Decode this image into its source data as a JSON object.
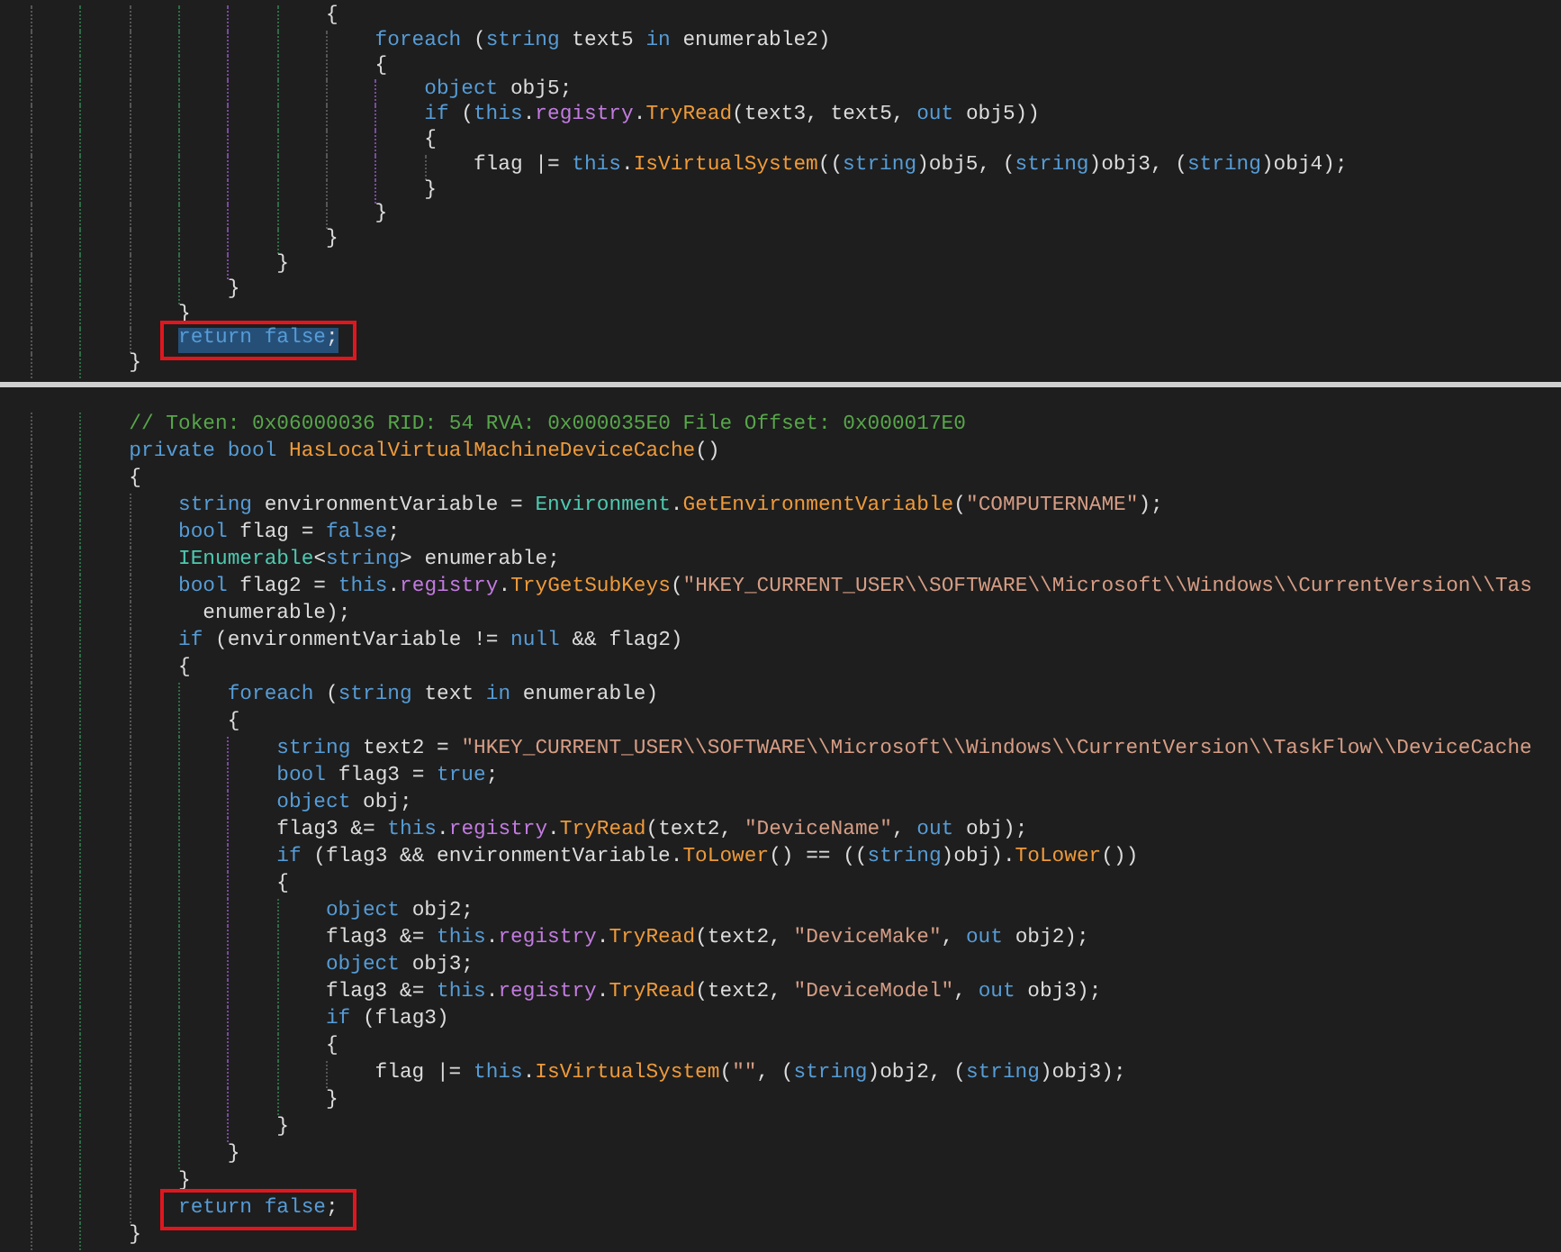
{
  "panels": [
    {
      "lines": [
        {
          "tokens": [
            {
              "kind": "plain",
              "text": "                        {"
            }
          ],
          "selected": false,
          "boxed": false
        },
        {
          "tokens": [
            {
              "kind": "kw",
              "text": "                            foreach"
            },
            {
              "kind": "plain",
              "text": " ("
            },
            {
              "kind": "kw",
              "text": "string"
            },
            {
              "kind": "plain",
              "text": " text5 "
            },
            {
              "kind": "kw",
              "text": "in"
            },
            {
              "kind": "plain",
              "text": " enumerable2)"
            }
          ],
          "selected": false,
          "boxed": false
        },
        {
          "tokens": [
            {
              "kind": "plain",
              "text": "                            {"
            }
          ],
          "selected": false,
          "boxed": false
        },
        {
          "tokens": [
            {
              "kind": "kw",
              "text": "                                object"
            },
            {
              "kind": "plain",
              "text": " obj5;"
            }
          ],
          "selected": false,
          "boxed": false
        },
        {
          "tokens": [
            {
              "kind": "kw",
              "text": "                                if"
            },
            {
              "kind": "plain",
              "text": " ("
            },
            {
              "kind": "kw",
              "text": "this"
            },
            {
              "kind": "plain",
              "text": "."
            },
            {
              "kind": "field",
              "text": "registry"
            },
            {
              "kind": "plain",
              "text": "."
            },
            {
              "kind": "method",
              "text": "TryRead"
            },
            {
              "kind": "plain",
              "text": "(text3, text5, "
            },
            {
              "kind": "kw",
              "text": "out"
            },
            {
              "kind": "plain",
              "text": " obj5))"
            }
          ],
          "selected": false,
          "boxed": false
        },
        {
          "tokens": [
            {
              "kind": "plain",
              "text": "                                {"
            }
          ],
          "selected": false,
          "boxed": false
        },
        {
          "tokens": [
            {
              "kind": "plain",
              "text": "                                    flag |= "
            },
            {
              "kind": "kw",
              "text": "this"
            },
            {
              "kind": "plain",
              "text": "."
            },
            {
              "kind": "method",
              "text": "IsVirtualSystem"
            },
            {
              "kind": "plain",
              "text": "(("
            },
            {
              "kind": "kw",
              "text": "string"
            },
            {
              "kind": "plain",
              "text": ")obj5, ("
            },
            {
              "kind": "kw",
              "text": "string"
            },
            {
              "kind": "plain",
              "text": ")obj3, ("
            },
            {
              "kind": "kw",
              "text": "string"
            },
            {
              "kind": "plain",
              "text": ")obj4);"
            }
          ],
          "selected": false,
          "boxed": false
        },
        {
          "tokens": [
            {
              "kind": "plain",
              "text": "                                }"
            }
          ],
          "selected": false,
          "boxed": false
        },
        {
          "tokens": [
            {
              "kind": "plain",
              "text": "                            }"
            }
          ],
          "selected": false,
          "boxed": false
        },
        {
          "tokens": [
            {
              "kind": "plain",
              "text": "                        }"
            }
          ],
          "selected": false,
          "boxed": false
        },
        {
          "tokens": [
            {
              "kind": "plain",
              "text": "                    }"
            }
          ],
          "selected": false,
          "boxed": false
        },
        {
          "tokens": [
            {
              "kind": "plain",
              "text": "                }"
            }
          ],
          "selected": false,
          "boxed": false
        },
        {
          "tokens": [
            {
              "kind": "plain",
              "text": "            }"
            }
          ],
          "selected": false,
          "boxed": false
        },
        {
          "tokens": [
            {
              "kind": "kw",
              "text": "            return"
            },
            {
              "kind": "kw",
              "text": " false"
            },
            {
              "kind": "plain",
              "text": ";"
            }
          ],
          "selected": true,
          "boxed": true
        },
        {
          "tokens": [
            {
              "kind": "plain",
              "text": "        }"
            }
          ],
          "selected": false,
          "boxed": false
        }
      ]
    },
    {
      "lines": [
        {
          "tokens": [
            {
              "kind": "comment",
              "text": "        // Token: 0x06000036 RID: 54 RVA: 0x000035E0 File Offset: 0x000017E0"
            }
          ],
          "selected": false,
          "boxed": false
        },
        {
          "tokens": [
            {
              "kind": "kw",
              "text": "        private"
            },
            {
              "kind": "kw",
              "text": " bool"
            },
            {
              "kind": "method",
              "text": " HasLocalVirtualMachineDeviceCache"
            },
            {
              "kind": "plain",
              "text": "()"
            }
          ],
          "selected": false,
          "boxed": false
        },
        {
          "tokens": [
            {
              "kind": "plain",
              "text": "        {"
            }
          ],
          "selected": false,
          "boxed": false
        },
        {
          "tokens": [
            {
              "kind": "kw",
              "text": "            string"
            },
            {
              "kind": "plain",
              "text": " environmentVariable = "
            },
            {
              "kind": "type",
              "text": "Environment"
            },
            {
              "kind": "plain",
              "text": "."
            },
            {
              "kind": "method",
              "text": "GetEnvironmentVariable"
            },
            {
              "kind": "plain",
              "text": "("
            },
            {
              "kind": "string",
              "text": "\"COMPUTERNAME\""
            },
            {
              "kind": "plain",
              "text": ");"
            }
          ],
          "selected": false,
          "boxed": false
        },
        {
          "tokens": [
            {
              "kind": "kw",
              "text": "            bool"
            },
            {
              "kind": "plain",
              "text": " flag = "
            },
            {
              "kind": "kw",
              "text": "false"
            },
            {
              "kind": "plain",
              "text": ";"
            }
          ],
          "selected": false,
          "boxed": false
        },
        {
          "tokens": [
            {
              "kind": "type",
              "text": "            IEnumerable"
            },
            {
              "kind": "plain",
              "text": "<"
            },
            {
              "kind": "kw",
              "text": "string"
            },
            {
              "kind": "plain",
              "text": "> enumerable;"
            }
          ],
          "selected": false,
          "boxed": false
        },
        {
          "tokens": [
            {
              "kind": "kw",
              "text": "            bool"
            },
            {
              "kind": "plain",
              "text": " flag2 = "
            },
            {
              "kind": "kw",
              "text": "this"
            },
            {
              "kind": "plain",
              "text": "."
            },
            {
              "kind": "field",
              "text": "registry"
            },
            {
              "kind": "plain",
              "text": "."
            },
            {
              "kind": "method",
              "text": "TryGetSubKeys"
            },
            {
              "kind": "plain",
              "text": "("
            },
            {
              "kind": "string",
              "text": "\"HKEY_CURRENT_USER\\\\SOFTWARE\\\\Microsoft\\\\Windows\\\\CurrentVersion\\\\Tas"
            }
          ],
          "selected": false,
          "boxed": false
        },
        {
          "tokens": [
            {
              "kind": "plain",
              "text": "              enumerable);"
            }
          ],
          "selected": false,
          "boxed": false
        },
        {
          "tokens": [
            {
              "kind": "kw",
              "text": "            if"
            },
            {
              "kind": "plain",
              "text": " (environmentVariable != "
            },
            {
              "kind": "kw",
              "text": "null"
            },
            {
              "kind": "plain",
              "text": " && flag2)"
            }
          ],
          "selected": false,
          "boxed": false
        },
        {
          "tokens": [
            {
              "kind": "plain",
              "text": "            {"
            }
          ],
          "selected": false,
          "boxed": false
        },
        {
          "tokens": [
            {
              "kind": "kw",
              "text": "                foreach"
            },
            {
              "kind": "plain",
              "text": " ("
            },
            {
              "kind": "kw",
              "text": "string"
            },
            {
              "kind": "plain",
              "text": " text "
            },
            {
              "kind": "kw",
              "text": "in"
            },
            {
              "kind": "plain",
              "text": " enumerable)"
            }
          ],
          "selected": false,
          "boxed": false
        },
        {
          "tokens": [
            {
              "kind": "plain",
              "text": "                {"
            }
          ],
          "selected": false,
          "boxed": false
        },
        {
          "tokens": [
            {
              "kind": "kw",
              "text": "                    string"
            },
            {
              "kind": "plain",
              "text": " text2 = "
            },
            {
              "kind": "string",
              "text": "\"HKEY_CURRENT_USER\\\\SOFTWARE\\\\Microsoft\\\\Windows\\\\CurrentVersion\\\\TaskFlow\\\\DeviceCache"
            }
          ],
          "selected": false,
          "boxed": false
        },
        {
          "tokens": [
            {
              "kind": "kw",
              "text": "                    bool"
            },
            {
              "kind": "plain",
              "text": " flag3 = "
            },
            {
              "kind": "kw",
              "text": "true"
            },
            {
              "kind": "plain",
              "text": ";"
            }
          ],
          "selected": false,
          "boxed": false
        },
        {
          "tokens": [
            {
              "kind": "kw",
              "text": "                    object"
            },
            {
              "kind": "plain",
              "text": " obj;"
            }
          ],
          "selected": false,
          "boxed": false
        },
        {
          "tokens": [
            {
              "kind": "plain",
              "text": "                    flag3 &= "
            },
            {
              "kind": "kw",
              "text": "this"
            },
            {
              "kind": "plain",
              "text": "."
            },
            {
              "kind": "field",
              "text": "registry"
            },
            {
              "kind": "plain",
              "text": "."
            },
            {
              "kind": "method",
              "text": "TryRead"
            },
            {
              "kind": "plain",
              "text": "(text2, "
            },
            {
              "kind": "string",
              "text": "\"DeviceName\""
            },
            {
              "kind": "plain",
              "text": ", "
            },
            {
              "kind": "kw",
              "text": "out"
            },
            {
              "kind": "plain",
              "text": " obj);"
            }
          ],
          "selected": false,
          "boxed": false
        },
        {
          "tokens": [
            {
              "kind": "kw",
              "text": "                    if"
            },
            {
              "kind": "plain",
              "text": " (flag3 && environmentVariable."
            },
            {
              "kind": "method",
              "text": "ToLower"
            },
            {
              "kind": "plain",
              "text": "() == (("
            },
            {
              "kind": "kw",
              "text": "string"
            },
            {
              "kind": "plain",
              "text": ")obj)."
            },
            {
              "kind": "method",
              "text": "ToLower"
            },
            {
              "kind": "plain",
              "text": "())"
            }
          ],
          "selected": false,
          "boxed": false
        },
        {
          "tokens": [
            {
              "kind": "plain",
              "text": "                    {"
            }
          ],
          "selected": false,
          "boxed": false
        },
        {
          "tokens": [
            {
              "kind": "kw",
              "text": "                        object"
            },
            {
              "kind": "plain",
              "text": " obj2;"
            }
          ],
          "selected": false,
          "boxed": false
        },
        {
          "tokens": [
            {
              "kind": "plain",
              "text": "                        flag3 &= "
            },
            {
              "kind": "kw",
              "text": "this"
            },
            {
              "kind": "plain",
              "text": "."
            },
            {
              "kind": "field",
              "text": "registry"
            },
            {
              "kind": "plain",
              "text": "."
            },
            {
              "kind": "method",
              "text": "TryRead"
            },
            {
              "kind": "plain",
              "text": "(text2, "
            },
            {
              "kind": "string",
              "text": "\"DeviceMake\""
            },
            {
              "kind": "plain",
              "text": ", "
            },
            {
              "kind": "kw",
              "text": "out"
            },
            {
              "kind": "plain",
              "text": " obj2);"
            }
          ],
          "selected": false,
          "boxed": false
        },
        {
          "tokens": [
            {
              "kind": "kw",
              "text": "                        object"
            },
            {
              "kind": "plain",
              "text": " obj3;"
            }
          ],
          "selected": false,
          "boxed": false
        },
        {
          "tokens": [
            {
              "kind": "plain",
              "text": "                        flag3 &= "
            },
            {
              "kind": "kw",
              "text": "this"
            },
            {
              "kind": "plain",
              "text": "."
            },
            {
              "kind": "field",
              "text": "registry"
            },
            {
              "kind": "plain",
              "text": "."
            },
            {
              "kind": "method",
              "text": "TryRead"
            },
            {
              "kind": "plain",
              "text": "(text2, "
            },
            {
              "kind": "string",
              "text": "\"DeviceModel\""
            },
            {
              "kind": "plain",
              "text": ", "
            },
            {
              "kind": "kw",
              "text": "out"
            },
            {
              "kind": "plain",
              "text": " obj3);"
            }
          ],
          "selected": false,
          "boxed": false
        },
        {
          "tokens": [
            {
              "kind": "kw",
              "text": "                        if"
            },
            {
              "kind": "plain",
              "text": " (flag3)"
            }
          ],
          "selected": false,
          "boxed": false
        },
        {
          "tokens": [
            {
              "kind": "plain",
              "text": "                        {"
            }
          ],
          "selected": false,
          "boxed": false
        },
        {
          "tokens": [
            {
              "kind": "plain",
              "text": "                            flag |= "
            },
            {
              "kind": "kw",
              "text": "this"
            },
            {
              "kind": "plain",
              "text": "."
            },
            {
              "kind": "method",
              "text": "IsVirtualSystem"
            },
            {
              "kind": "plain",
              "text": "("
            },
            {
              "kind": "string",
              "text": "\"\""
            },
            {
              "kind": "plain",
              "text": ", ("
            },
            {
              "kind": "kw",
              "text": "string"
            },
            {
              "kind": "plain",
              "text": ")obj2, ("
            },
            {
              "kind": "kw",
              "text": "string"
            },
            {
              "kind": "plain",
              "text": ")obj3);"
            }
          ],
          "selected": false,
          "boxed": false
        },
        {
          "tokens": [
            {
              "kind": "plain",
              "text": "                        }"
            }
          ],
          "selected": false,
          "boxed": false
        },
        {
          "tokens": [
            {
              "kind": "plain",
              "text": "                    }"
            }
          ],
          "selected": false,
          "boxed": false
        },
        {
          "tokens": [
            {
              "kind": "plain",
              "text": "                }"
            }
          ],
          "selected": false,
          "boxed": false
        },
        {
          "tokens": [
            {
              "kind": "plain",
              "text": "            }"
            }
          ],
          "selected": false,
          "boxed": false
        },
        {
          "tokens": [
            {
              "kind": "kw",
              "text": "            return"
            },
            {
              "kind": "kw",
              "text": " false"
            },
            {
              "kind": "plain",
              "text": ";"
            }
          ],
          "selected": false,
          "boxed": true
        },
        {
          "tokens": [
            {
              "kind": "plain",
              "text": "        }"
            }
          ],
          "selected": false,
          "boxed": false
        }
      ]
    }
  ]
}
